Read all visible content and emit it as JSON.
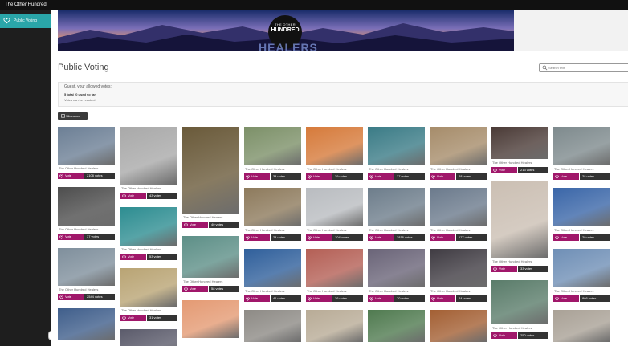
{
  "app": {
    "window_title": "The Other Hundred"
  },
  "sidebar": {
    "items": [
      {
        "label": "Public Voting",
        "icon": "heart-icon"
      }
    ]
  },
  "banner": {
    "logo_sup": "THE OTHER",
    "logo_main": "HUNDRED",
    "logo_sub": "",
    "word": "HEALERS"
  },
  "page": {
    "title": "Public Voting"
  },
  "search": {
    "placeholder": "Search text"
  },
  "vote_info": {
    "heading": "Guest, your allowed votes:",
    "total": "5 total (0 used so far)",
    "note": "Votes can be revoked"
  },
  "slideshow": {
    "label": "Slideshow"
  },
  "card_caption": "The Other Hundred Healers",
  "vote_label": "Vote",
  "colors": {
    "accent": "#a0176a",
    "nav_active": "#2aa6a9",
    "count_bg": "#333333",
    "topbar": "#111111",
    "sidebar": "#1e1e1e"
  },
  "columns": [
    {
      "cards": [
        {
          "votes": "2108 votes",
          "photo_color": "#6c7f95"
        },
        {
          "votes": "37 votes",
          "photo_color": "#4d4d4d"
        },
        {
          "votes": "2544 votes",
          "photo_color": "#7f8f9c"
        },
        {
          "votes": "",
          "photo_color": "#3f5e8b"
        }
      ]
    },
    {
      "cards": [
        {
          "votes": "43 votes",
          "photo_color": "#a9a9a9"
        },
        {
          "votes": "53 votes",
          "photo_color": "#2d8d91"
        },
        {
          "votes": "31 votes",
          "photo_color": "#b9a474"
        },
        {
          "votes": "",
          "photo_color": "#5b5b6b"
        }
      ]
    },
    {
      "cards": [
        {
          "votes": "40 votes",
          "photo_color": "#6a5a3a"
        },
        {
          "votes": "58 votes",
          "photo_color": "#5d8f87"
        },
        {
          "votes": "",
          "photo_color": "#e49a73"
        }
      ]
    },
    {
      "cards": [
        {
          "votes": "34 votes",
          "photo_color": "#7c9068"
        },
        {
          "votes": "24 votes",
          "photo_color": "#8d7a5c"
        },
        {
          "votes": "41 votes",
          "photo_color": "#2f5f9b"
        },
        {
          "votes": "",
          "photo_color": "#8d8a85"
        }
      ]
    },
    {
      "cards": [
        {
          "votes": "39 votes",
          "photo_color": "#d67a3a"
        },
        {
          "votes": "104 votes",
          "photo_color": "#b9bcc0"
        },
        {
          "votes": "36 votes",
          "photo_color": "#b45f55"
        },
        {
          "votes": "",
          "photo_color": "#b8ab96"
        }
      ]
    },
    {
      "cards": [
        {
          "votes": "27 votes",
          "photo_color": "#3a7b86"
        },
        {
          "votes": "3816 votes",
          "photo_color": "#6d7d8b"
        },
        {
          "votes": "70 votes",
          "photo_color": "#6a6478"
        },
        {
          "votes": "",
          "photo_color": "#4f7a4f"
        }
      ]
    },
    {
      "cards": [
        {
          "votes": "28 votes",
          "photo_color": "#a68c6a"
        },
        {
          "votes": "177 votes",
          "photo_color": "#6b7a8c"
        },
        {
          "votes": "24 votes",
          "photo_color": "#3f3b42"
        },
        {
          "votes": "",
          "photo_color": "#a35f33"
        }
      ]
    },
    {
      "cards": [
        {
          "votes": "213 votes",
          "photo_color": "#4a3a36"
        },
        {
          "votes": "33 votes",
          "photo_color": "#cbbfb3"
        },
        {
          "votes": "250 votes",
          "photo_color": "#5a7c6a"
        }
      ]
    },
    {
      "cards": [
        {
          "votes": "28 votes",
          "photo_color": "#7e8a8d"
        },
        {
          "votes": "29 votes",
          "photo_color": "#3a66a8"
        },
        {
          "votes": "866 votes",
          "photo_color": "#6f8fb6"
        },
        {
          "votes": "",
          "photo_color": "#a9a196"
        }
      ]
    }
  ]
}
